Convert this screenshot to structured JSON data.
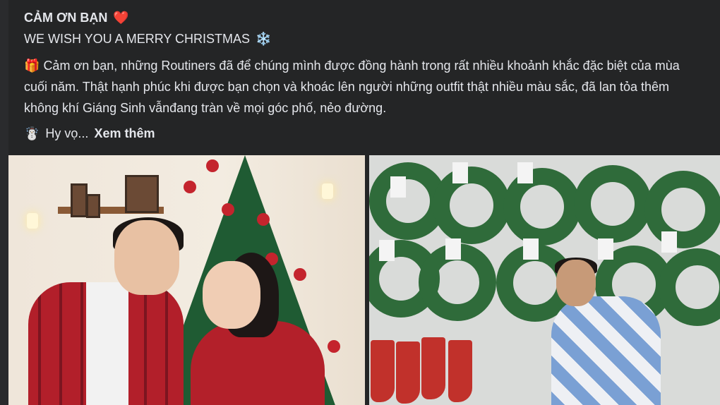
{
  "post": {
    "title": "CẢM ƠN BẠN",
    "title_emoji": "❤️",
    "subtitle": "WE WISH YOU A MERRY CHRISTMAS",
    "subtitle_emoji": "❄️",
    "gift_emoji": "🎁",
    "body": "Cảm ơn bạn, những Routiners đã để chúng mình được đồng hành trong rất nhiều khoảnh khắc đặc biệt của mùa cuối năm. Thật hạnh phúc khi được bạn chọn và khoác lên người những outfit thật nhiều màu sắc, đã lan tỏa thêm không khí Giáng Sinh vẫnđang tràn về mọi góc phố, nẻo đường.",
    "snowman_emoji": "☃️",
    "preview": "Hy vọ...",
    "see_more": "Xem thêm"
  },
  "colors": {
    "background": "#242526",
    "text": "#e4e6eb"
  }
}
